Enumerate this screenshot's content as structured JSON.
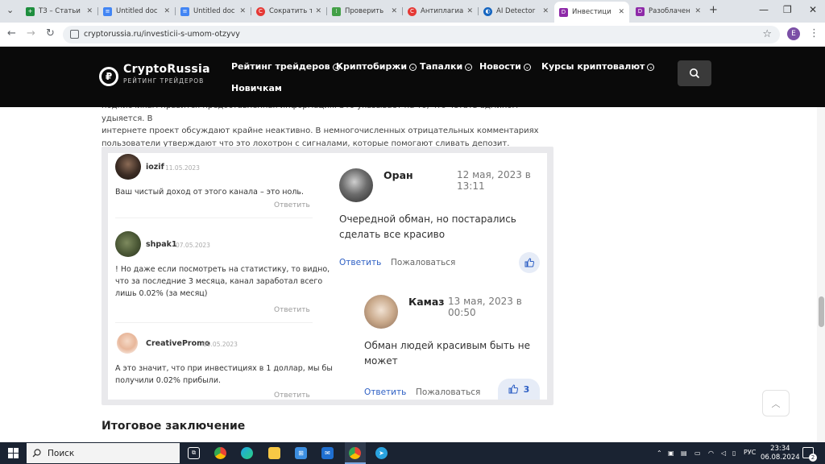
{
  "browser": {
    "tabs": [
      {
        "label": "ТЗ – Статьи",
        "favicon_color": "#1e8e3e",
        "favicon_glyph": "+"
      },
      {
        "label": "Untitled doc",
        "favicon_color": "#4285f4",
        "favicon_glyph": "≡"
      },
      {
        "label": "Untitled doc",
        "favicon_color": "#4285f4",
        "favicon_glyph": "≡"
      },
      {
        "label": "Сократить т",
        "favicon_color": "#e53935",
        "favicon_glyph": "C"
      },
      {
        "label": "Проверить",
        "favicon_color": "#43a047",
        "favicon_glyph": "⁞"
      },
      {
        "label": "Антиплагиат",
        "favicon_color": "#e53935",
        "favicon_glyph": "C"
      },
      {
        "label": "AI Detector",
        "favicon_color": "#1565c0",
        "favicon_glyph": "◐"
      },
      {
        "label": "Инвестици",
        "favicon_color": "#8e2aa8",
        "favicon_glyph": "D"
      },
      {
        "label": "Разоблачен",
        "favicon_color": "#8e2aa8",
        "favicon_glyph": "D"
      }
    ],
    "active_tab_index": 7,
    "url": "cryptorussia.ru/investicii-s-umom-otzyvy",
    "profile_initial": "E"
  },
  "site": {
    "logo_name": "CryptoRussia",
    "logo_tagline": "РЕЙТИНГ ТРЕЙДЕРОВ",
    "nav": [
      {
        "label": "Рейтинг трейдеров",
        "has_dropdown": true
      },
      {
        "label": "Криптобиржи",
        "has_dropdown": true
      },
      {
        "label": "Тапалки",
        "has_dropdown": true
      },
      {
        "label": "Новости",
        "has_dropdown": true
      },
      {
        "label": "Курсы криптовалют",
        "has_dropdown": true
      },
      {
        "label": "Новичкам",
        "has_dropdown": false
      }
    ]
  },
  "article": {
    "paragraph_lines": [
      "подписчикам нравится предоставленная информация. Это указывает на то, что четать админом удыяется. В",
      "интернете проект обсуждают крайне неактивно. В немногочисленных отрицательных комментариях",
      "пользователи утверждают что это лохотрон с сигналами, которые помогают сливать депозит."
    ],
    "left_comments": [
      {
        "author": "iozif",
        "date": "11.05.2023",
        "text_lines": [
          "Ваш чистый доход от этого канала – это ноль."
        ],
        "reply": "Ответить"
      },
      {
        "author": "shpak1",
        "date": "07.05.2023",
        "text_lines": [
          "! Но даже если посмотреть на статистику, то видно,",
          "что за последние 3 месяца, канал заработал всего",
          "лишь 0.02% (за месяц)"
        ],
        "reply": "Ответить"
      },
      {
        "author": "CreativePromo",
        "date": "09.05.2023",
        "text_lines": [
          "А это значит, что при инвестициях в 1 доллар, мы бы",
          "получили 0.02% прибыли."
        ],
        "reply": "Ответить"
      }
    ],
    "right_comments": [
      {
        "author": "Оран",
        "date": "12 мая, 2023 в 13:11",
        "text_lines": [
          "Очередной обман, но постарались",
          "сделать все красиво"
        ],
        "reply": "Ответить",
        "report": "Пожаловаться",
        "likes": ""
      },
      {
        "author": "Камаз",
        "date": "13 мая, 2023 в 00:50",
        "text_lines": [
          "Обман людей красивым быть не",
          "может"
        ],
        "reply": "Ответить",
        "report": "Пожаловаться",
        "likes": "3"
      }
    ],
    "conclusion_heading": "Итоговое заключение"
  },
  "taskbar": {
    "search_label": "Поиск",
    "language": "РУС",
    "time": "23:34",
    "date": "06.08.2024",
    "notification_count": "2"
  }
}
